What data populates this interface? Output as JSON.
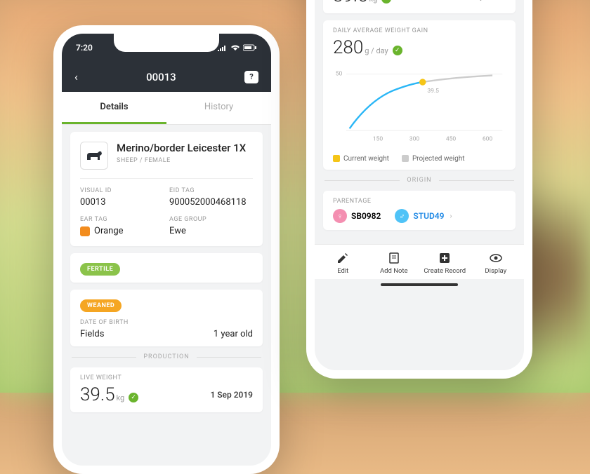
{
  "status_time": "7:20",
  "header": {
    "id": "00013"
  },
  "tabs": {
    "details": "Details",
    "history": "History"
  },
  "animal": {
    "name": "Merino/border Leicester 1X",
    "subtitle": "SHEEP / FEMALE"
  },
  "fields": {
    "visual_id_lbl": "VISUAL ID",
    "visual_id": "00013",
    "eid_lbl": "EID TAG",
    "eid": "900052000468118",
    "ear_lbl": "EAR TAG",
    "ear": "Orange",
    "age_grp_lbl": "AGE GROUP",
    "age_grp": "Ewe"
  },
  "badges": {
    "fertile": "FERTILE",
    "weaned": "WEANED"
  },
  "birth": {
    "dob_lbl": "DATE OF BIRTH",
    "loc": "Fields",
    "age": "1 year old"
  },
  "sections": {
    "production": "PRODUCTION",
    "origin": "ORIGIN"
  },
  "weight": {
    "lbl": "LIVE WEIGHT",
    "val": "39.5",
    "unit": "kg",
    "date": "1 Sep 2019"
  },
  "gain": {
    "lbl": "DAILY AVERAGE WEIGHT GAIN",
    "val": "280",
    "unit": "g / day"
  },
  "legend": {
    "current": "Current weight",
    "projected": "Projected weight"
  },
  "chart_marker": "39.5",
  "parentage": {
    "lbl": "PARENTAGE",
    "mother": "SB0982",
    "father": "STUD49"
  },
  "toolbar": {
    "edit": "Edit",
    "note": "Add Note",
    "record": "Create Record",
    "display": "Display"
  },
  "chart_data": {
    "type": "line",
    "x": [
      50,
      150,
      250,
      300,
      350,
      450,
      600
    ],
    "series": [
      {
        "name": "Current weight",
        "values": [
          5,
          22,
          33,
          39.5,
          null,
          null,
          null
        ]
      },
      {
        "name": "Projected weight",
        "values": [
          null,
          null,
          null,
          39.5,
          42,
          46,
          48
        ]
      }
    ],
    "xlim": [
      0,
      650
    ],
    "ylim": [
      0,
      50
    ],
    "xticks": [
      150,
      300,
      450,
      600
    ],
    "yticks": [
      50
    ],
    "marker": {
      "x": 300,
      "y": 39.5,
      "label": "39.5"
    }
  }
}
